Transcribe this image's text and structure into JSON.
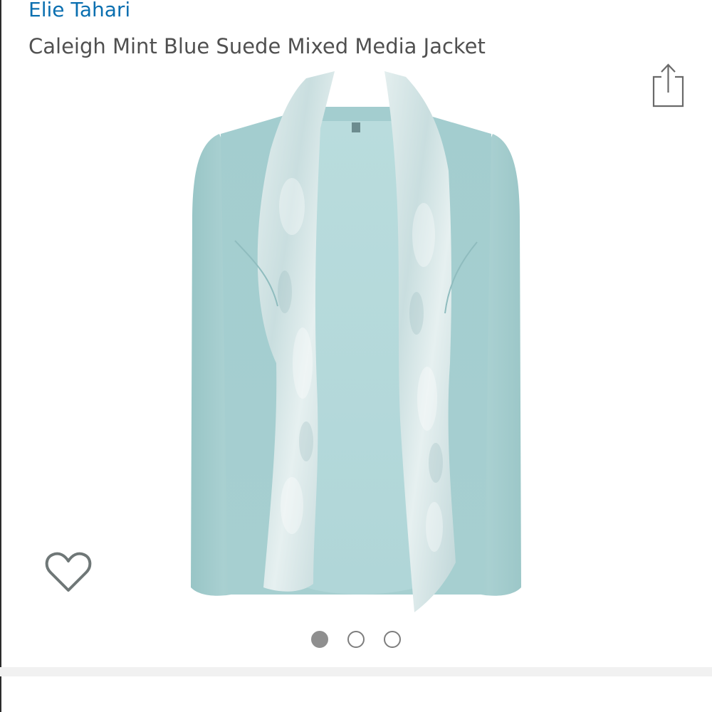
{
  "header": {
    "brand": "Elie Tahari",
    "title": "Caleigh Mint Blue Suede Mixed Media Jacket"
  },
  "actions": {
    "share_icon": "share-icon",
    "wishlist_icon": "heart-outline-icon"
  },
  "gallery": {
    "image_count": 3,
    "active_index": 0,
    "image_description_colors": {
      "jacket_body": "#a8cfcf",
      "suede_panel": "#d9e6e6",
      "lining": "#b3d9db"
    }
  },
  "colors": {
    "brand_link": "#0a6fb0",
    "title_text": "#505050",
    "dot_active": "#8f8f8f",
    "dot_inactive_border": "#7d7d7d",
    "divider": "#f1f1f1"
  }
}
